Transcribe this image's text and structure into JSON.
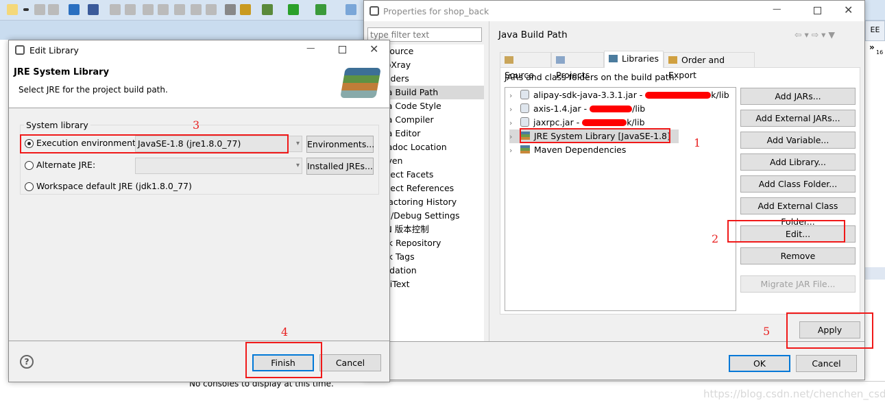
{
  "eclipse": {
    "toolbar_icons": [
      "new-wizard-icon",
      "dropdown-icon",
      "save-icon",
      "save-all-icon",
      "terminal-icon",
      "skip-breakpoints-icon",
      "resume-icon",
      "suspend-icon",
      "terminate-icon",
      "disconnect-icon",
      "step-into-icon",
      "step-over-icon",
      "step-return-icon",
      "build-icon",
      "external-tools-icon",
      "debug-icon",
      "run-icon",
      "run-external-icon",
      "open-perspective-icon"
    ],
    "perspective_label": "EE",
    "side_marker": "»",
    "side_number": "16",
    "console_text": "No consoles to display at this time.",
    "watermark": "https://blog.csdn.net/chenchen_csdn"
  },
  "properties": {
    "title": "Properties for shop_back",
    "filter_placeholder": "type filter text",
    "tree": [
      "Resource",
      "AppXray",
      "Builders",
      "Java Build Path",
      "Java Code Style",
      "Java Compiler",
      "Java Editor",
      "Javadoc Location",
      "Maven",
      "Project Facets",
      "Project References",
      "Refactoring History",
      "Run/Debug Settings",
      "SVN 版本控制",
      "Task Repository",
      "Task Tags",
      "Validation",
      "WikiText"
    ],
    "selected_tree": "Java Build Path",
    "page_title": "Java Build Path",
    "tabs": [
      {
        "label": "Source",
        "icon": "source-folder-icon"
      },
      {
        "label": "Projects",
        "icon": "folder-icon"
      },
      {
        "label": "Libraries",
        "icon": "library-icon",
        "active": true
      },
      {
        "label": "Order and Export",
        "icon": "order-icon"
      }
    ],
    "list_label": "JARs and class folders on the build path:",
    "entries": [
      {
        "label": "alipay-sdk-java-3.3.1.jar - ",
        "suffix": "k/lib",
        "icon": "jar-icon"
      },
      {
        "label": "axis-1.4.jar - ",
        "suffix": "/lib",
        "icon": "jar-icon"
      },
      {
        "label": "jaxrpc.jar - ",
        "suffix": "k/lib",
        "icon": "jar-icon"
      },
      {
        "label": "JRE System Library [JavaSE-1.8]",
        "suffix": "",
        "icon": "library-icon"
      },
      {
        "label": "Maven Dependencies",
        "suffix": "",
        "icon": "library-icon"
      }
    ],
    "buttons": [
      "Add JARs...",
      "Add External JARs...",
      "Add Variable...",
      "Add Library...",
      "Add Class Folder...",
      "Add External Class Folder...",
      "Edit...",
      "Remove",
      "Migrate JAR File..."
    ],
    "apply": "Apply",
    "ok": "OK",
    "cancel": "Cancel"
  },
  "edit_library": {
    "title": "Edit Library",
    "header_title": "JRE System Library",
    "header_desc": "Select JRE for the project build path.",
    "group_label": "System library",
    "options": [
      {
        "label": "Execution environment:",
        "value": "JavaSE-1.8 (jre1.8.0_77)",
        "button": "Environments...",
        "selected": true
      },
      {
        "label": "Alternate JRE:",
        "value": "",
        "button": "Installed JREs...",
        "selected": false
      },
      {
        "label": "Workspace default JRE (jdk1.8.0_77)",
        "selected": false
      }
    ],
    "finish": "Finish",
    "cancel": "Cancel"
  },
  "annotations": [
    "1",
    "2",
    "3",
    "4",
    "5"
  ],
  "colors": {
    "annotation": "#f01818",
    "focus": "#0078d7",
    "selection": "#cce8ff"
  }
}
